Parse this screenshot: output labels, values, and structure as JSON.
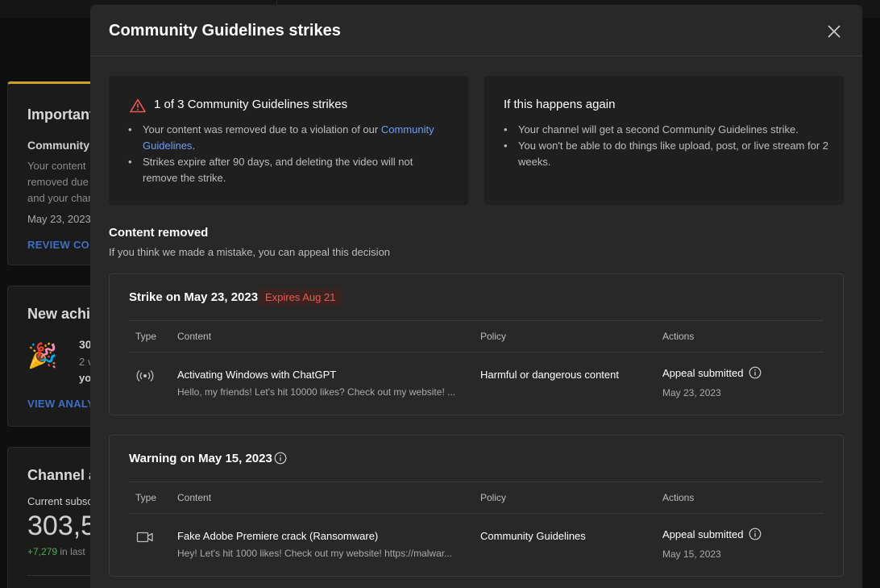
{
  "background": {
    "important_card": {
      "title": "Important",
      "subtitle": "Community",
      "text_lines": [
        "Your content",
        "removed due",
        "and your char"
      ],
      "date": "May 23, 2023",
      "link": "REVIEW CON"
    },
    "achievement_card": {
      "title": "New achie",
      "line1": "30",
      "line2": "2 v",
      "line3": "yo",
      "link": "VIEW ANALY"
    },
    "analytics_card": {
      "title": "Channel a",
      "subtitle": "Current subsc",
      "big_number": "303,5",
      "delta": "+7,279",
      "delta_suffix": "in last"
    }
  },
  "modal": {
    "title": "Community Guidelines strikes",
    "close_icon": "close-icon",
    "strike_info": {
      "heading": "1 of 3 Community Guidelines strikes",
      "bullet1_text": "Your content was removed due to a violation of our ",
      "bullet1_link": "Community Guidelines",
      "bullet1_end": ".",
      "bullet2": "Strikes expire after 90 days, and deleting the video will not remove the strike."
    },
    "again_info": {
      "heading": "If this happens again",
      "bullet1": "Your channel will get a second Community Guidelines strike.",
      "bullet2": "You won't be able to do things like upload, post, or live stream for 2 weeks."
    },
    "section": {
      "title": "Content removed",
      "subtitle": "If you think we made a mistake, you can appeal this decision"
    },
    "columns": {
      "type": "Type",
      "content": "Content",
      "policy": "Policy",
      "actions": "Actions"
    },
    "strike_card": {
      "title": "Strike on May 23, 2023",
      "badge": "Expires Aug 21",
      "row": {
        "type_icon": "live-stream-icon",
        "content_title": "Activating Windows with ChatGPT",
        "content_desc": "Hello, my friends! Let's hit 10000 likes? Check out my website! ...",
        "policy": "Harmful or dangerous content",
        "action": "Appeal submitted",
        "action_date": "May 23, 2023"
      }
    },
    "warning_card": {
      "title": "Warning on May 15, 2023",
      "row": {
        "type_icon": "video-icon",
        "content_title": "Fake Adobe Premiere crack (Ransomware)",
        "content_desc": "Hey! Let's hit 1000 likes! Check out my website! https://malwar...",
        "policy": "Community Guidelines",
        "action": "Appeal submitted",
        "action_date": "May 15, 2023"
      }
    }
  },
  "colors": {
    "link": "#6e9ef6",
    "warning_red": "#ec5a4f",
    "modal_bg": "#282828",
    "panel_bg": "#1f1f1f"
  }
}
